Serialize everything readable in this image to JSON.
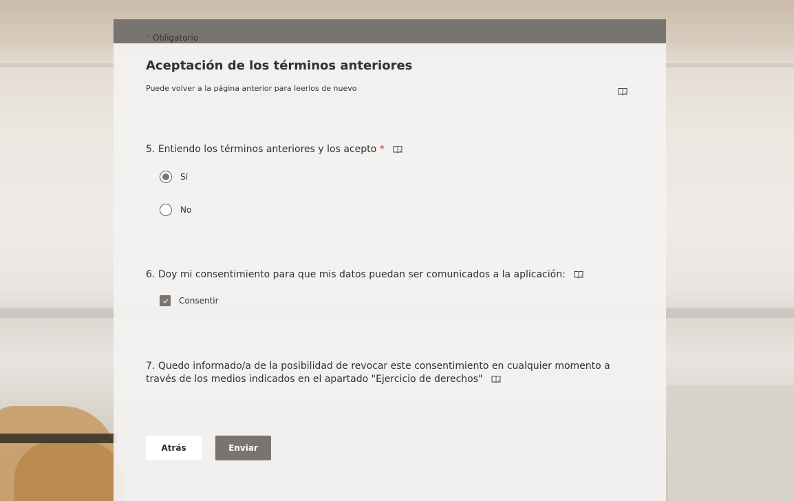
{
  "form": {
    "required_note_star": "*",
    "required_note": "Obligatorio",
    "section_title": "Aceptación de los términos anteriores",
    "section_subtitle": "Puede volver a la página anterior para leerlos de nuevo"
  },
  "questions": [
    {
      "number": "5.",
      "text": "Entiendo los términos anteriores y los acepto",
      "required_star": "*",
      "options": [
        {
          "label": "Sí",
          "selected": true
        },
        {
          "label": "No",
          "selected": false
        }
      ]
    },
    {
      "number": "6.",
      "text": "Doy mi consentimiento para que mis datos puedan ser comunicados a la aplicación:",
      "options": [
        {
          "label": "Consentir",
          "checked": true
        }
      ]
    },
    {
      "number": "7.",
      "text": "Quedo informado/a de la posibilidad de revocar este consentimiento en cualquier momento a través de los medios indicados en el apartado \"Ejercicio de derechos\""
    }
  ],
  "buttons": {
    "back_label": "Atrás",
    "send_label": "Enviar"
  },
  "icons": {
    "reader": "immersive-reader-icon",
    "check": "check-icon"
  },
  "colors": {
    "header": "#78746f",
    "required": "#c4314b",
    "accent": "#7a7672"
  }
}
